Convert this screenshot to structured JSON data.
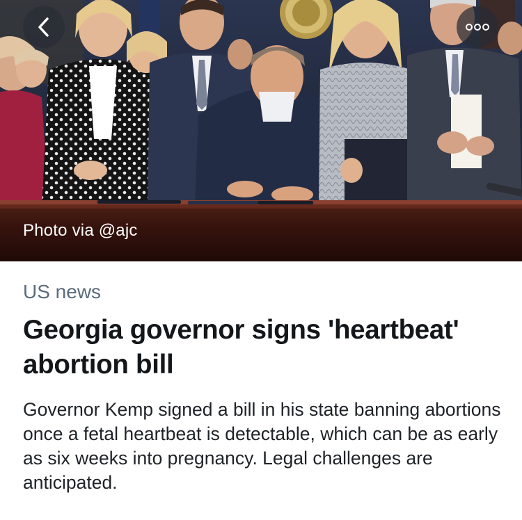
{
  "hero": {
    "photo_credit": "Photo via @ajc",
    "back_icon": "chevron-left-icon",
    "more_icon": "more-horizontal-icon"
  },
  "article": {
    "category": "US news",
    "headline": "Georgia governor signs 'heartbeat' abortion bill",
    "summary": "Governor Kemp signed a bill in his state banning abortions once a fetal heartbeat is detectable, which can be as early as six weeks into pregnancy. Legal challenges are anticipated."
  },
  "colors": {
    "background": "#ffffff",
    "headline": "#14171a",
    "category": "#5b6b7b",
    "summary": "#1f2327",
    "icon_button_bg": "#282c34"
  }
}
